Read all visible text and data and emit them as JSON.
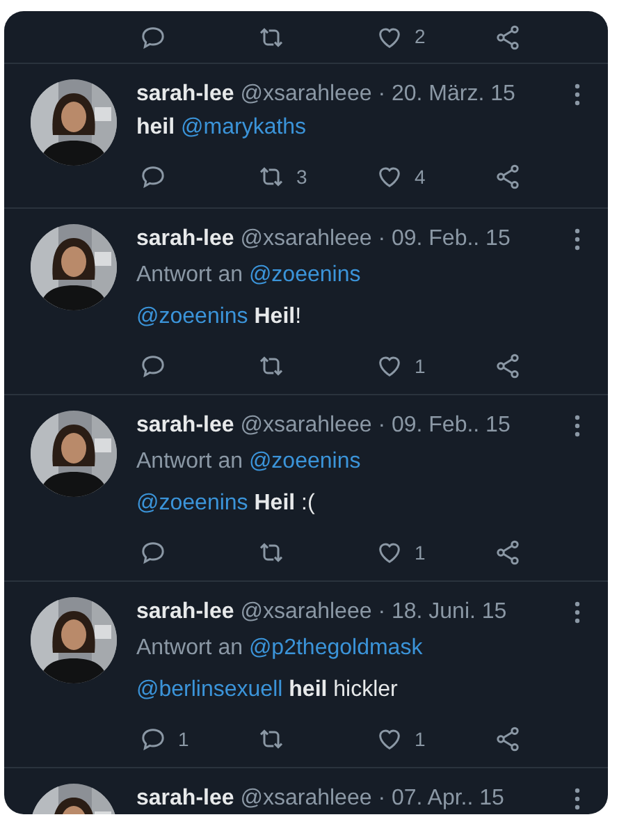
{
  "top_actions": {
    "likes": "2"
  },
  "tweets": [
    {
      "name": "sarah-lee",
      "handle": "@xsarahleee",
      "date": "· 20. März. 15",
      "body": [
        {
          "kind": "text",
          "text": "**heil**"
        },
        {
          "kind": "mention",
          "text": "@marykaths"
        }
      ],
      "actions": {
        "retweets": "3",
        "likes": "4"
      }
    },
    {
      "name": "sarah-lee",
      "handle": "@xsarahleee",
      "date": "· 09. Feb.. 15",
      "reply_prefix": "Antwort an",
      "reply_to": "@zoeenins",
      "body": [
        {
          "kind": "mention",
          "text": "@zoeenins"
        },
        {
          "kind": "text",
          "text": "**Heil**!"
        }
      ],
      "actions": {
        "likes": "1"
      }
    },
    {
      "name": "sarah-lee",
      "handle": "@xsarahleee",
      "date": "· 09. Feb.. 15",
      "reply_prefix": "Antwort an",
      "reply_to": "@zoeenins",
      "body": [
        {
          "kind": "mention",
          "text": "@zoeenins"
        },
        {
          "kind": "text",
          "text": "**Heil** :("
        }
      ],
      "actions": {
        "likes": "1"
      }
    },
    {
      "name": "sarah-lee",
      "handle": "@xsarahleee",
      "date": "· 18. Juni. 15",
      "reply_prefix": "Antwort an",
      "reply_to": "@p2thegoldmask",
      "body": [
        {
          "kind": "mention",
          "text": "@berlinsexuell"
        },
        {
          "kind": "text",
          "text": "**heil** hickler"
        }
      ],
      "actions": {
        "replies": "1",
        "likes": "1"
      }
    },
    {
      "name": "sarah-lee",
      "handle": "@xsarahleee",
      "date": "· 07. Apr.. 15"
    }
  ]
}
